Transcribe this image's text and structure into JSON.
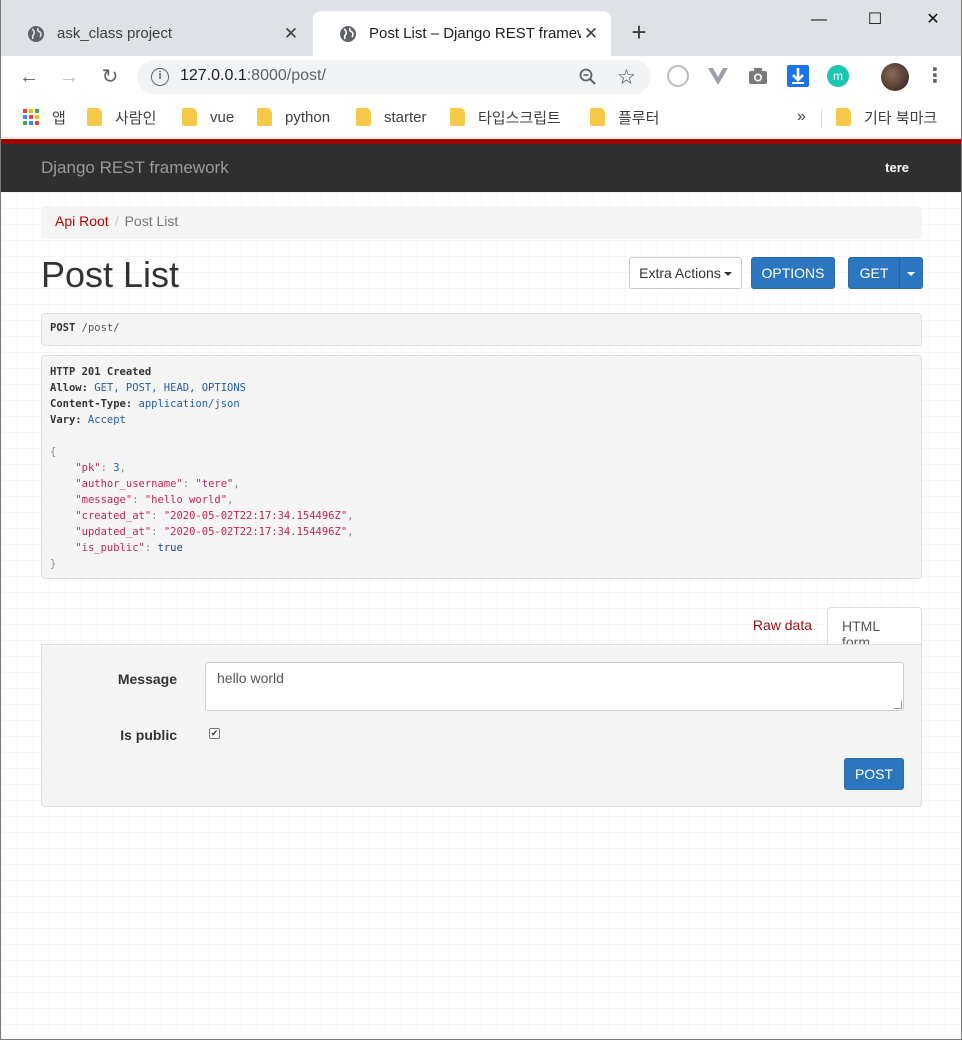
{
  "browser": {
    "tabs": [
      {
        "title": "ask_class project",
        "active": false
      },
      {
        "title": "Post List – Django REST framew",
        "active": true
      }
    ],
    "new_tab": "+",
    "window_controls": {
      "minimize": "—",
      "maximize": "☐",
      "close": "✕"
    },
    "url_host": "127.0.0.1",
    "url_rest": ":8000/post/",
    "info_icon": "i",
    "bookmarks": [
      {
        "label": "앱",
        "icon": "apps-grid-icon"
      },
      {
        "label": "사람인",
        "icon": "folder-icon"
      },
      {
        "label": "vue",
        "icon": "folder-icon"
      },
      {
        "label": "python",
        "icon": "folder-icon"
      },
      {
        "label": "starter",
        "icon": "folder-icon"
      },
      {
        "label": "타입스크립트",
        "icon": "folder-icon"
      },
      {
        "label": "플루터",
        "icon": "folder-icon"
      }
    ],
    "bookmarks_overflow": "»",
    "other_bookmarks": "기타 북마크",
    "colors": {
      "tab_strip": "#dee1e6",
      "omnibox": "#f1f3f4",
      "folder": "#f7c948"
    }
  },
  "navbar": {
    "brand": "Django REST framework",
    "user": "tere",
    "colors": {
      "top_stripe": "#a30000",
      "bar": "#2f2f2f"
    }
  },
  "breadcrumb": {
    "root": "Api Root",
    "separator": "/",
    "current": "Post List"
  },
  "page": {
    "title": "Post List",
    "extra_actions": "Extra Actions",
    "options": "OPTIONS",
    "get": "GET",
    "accent": "#2c76c0"
  },
  "request": {
    "method": "POST",
    "path": " /post/"
  },
  "response": {
    "status": "HTTP 201 Created",
    "headers": [
      {
        "name": "Allow:",
        "value": " GET, POST, HEAD, OPTIONS"
      },
      {
        "name": "Content-Type:",
        "value": " application/json"
      },
      {
        "name": "Vary:",
        "value": " Accept"
      }
    ],
    "open_brace": "{",
    "close_brace": "}",
    "body": [
      {
        "key": "\"pk\"",
        "value": "3",
        "type": "num",
        "comma": ","
      },
      {
        "key": "\"author_username\"",
        "value": "\"tere\"",
        "type": "str",
        "comma": ","
      },
      {
        "key": "\"message\"",
        "value": "\"hello world\"",
        "type": "str",
        "comma": ","
      },
      {
        "key": "\"created_at\"",
        "value": "\"2020-05-02T22:17:34.154496Z\"",
        "type": "str",
        "comma": ","
      },
      {
        "key": "\"updated_at\"",
        "value": "\"2020-05-02T22:17:34.154496Z\"",
        "type": "str",
        "comma": ","
      },
      {
        "key": "\"is_public\"",
        "value": "true",
        "type": "lit",
        "comma": ""
      }
    ]
  },
  "form": {
    "tabs": {
      "raw": "Raw data",
      "html": "HTML form"
    },
    "message_label": "Message",
    "message_value": "hello world",
    "is_public_label": "Is public",
    "is_public_checked": true,
    "check_glyph": "✔",
    "submit": "POST"
  }
}
